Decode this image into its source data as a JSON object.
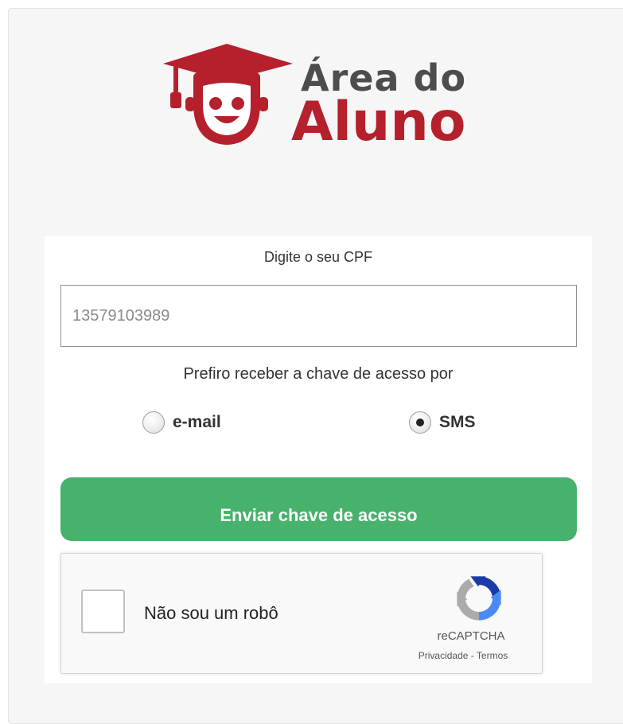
{
  "logo": {
    "line1": "Área do",
    "line2": "Aluno",
    "brand_red": "#b5202c",
    "brand_gray": "#4d4d4d"
  },
  "form": {
    "cpf_label": "Digite o seu CPF",
    "cpf_value": "13579103989",
    "preference_label": "Prefiro receber a chave de acesso por",
    "options": [
      {
        "label": "e-mail",
        "checked": false
      },
      {
        "label": "SMS",
        "checked": true
      }
    ],
    "submit_label": "Enviar chave de acesso",
    "submit_color": "#47b26b"
  },
  "recaptcha": {
    "label": "Não sou um robô",
    "brand": "reCAPTCHA",
    "privacy": "Privacidade",
    "separator": " - ",
    "terms": "Termos",
    "icon": "recaptcha-icon"
  }
}
